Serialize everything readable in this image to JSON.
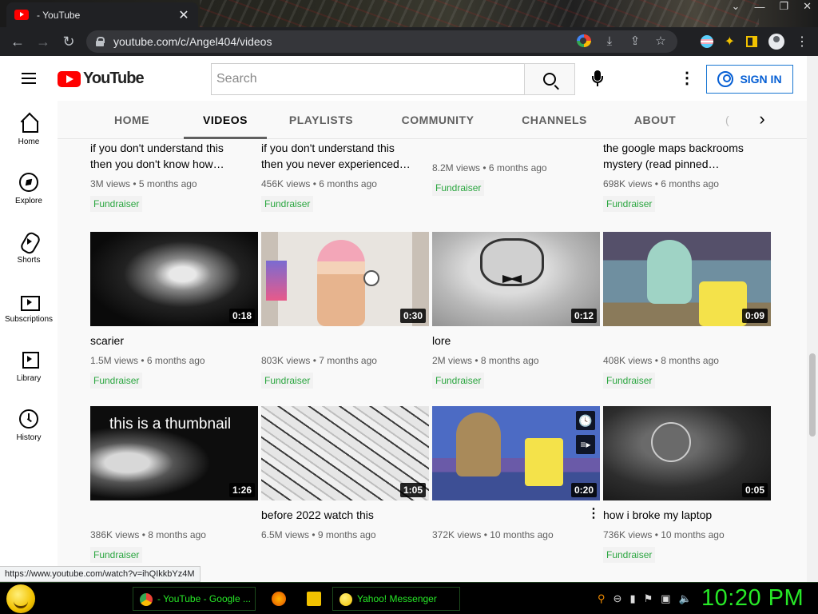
{
  "browser": {
    "tab_title": "- YouTube",
    "tab_close": "✕",
    "url": "youtube.com/c/Angel404/videos",
    "status_url": "https://www.youtube.com/watch?v=ihQIkkbYz4M"
  },
  "youtube": {
    "logo_text": "YouTube",
    "search_placeholder": "Search",
    "signin_label": "SIGN IN"
  },
  "guide": [
    {
      "label": "Home",
      "icon": "home-icon"
    },
    {
      "label": "Explore",
      "icon": "compass-icon"
    },
    {
      "label": "Shorts",
      "icon": "shorts-icon"
    },
    {
      "label": "Subscriptions",
      "icon": "subscriptions-icon"
    },
    {
      "label": "Library",
      "icon": "library-icon"
    },
    {
      "label": "History",
      "icon": "history-icon"
    }
  ],
  "channel_tabs": [
    {
      "label": "HOME"
    },
    {
      "label": "VIDEOS",
      "active": true
    },
    {
      "label": "PLAYLISTS"
    },
    {
      "label": "COMMUNITY"
    },
    {
      "label": "CHANNELS"
    },
    {
      "label": "ABOUT"
    }
  ],
  "videos_row0": [
    {
      "title1": "if you don't understand this",
      "title2": "then you don't know how…",
      "meta": "3M views • 5 months ago",
      "badge": "Fundraiser"
    },
    {
      "title1": "if you don't understand this",
      "title2": "then you never experienced…",
      "meta": "456K views • 6 months ago",
      "badge": "Fundraiser"
    },
    {
      "title1": "",
      "title2": "",
      "meta": "8.2M views • 6 months ago",
      "badge": "Fundraiser"
    },
    {
      "title1": "the google maps backrooms",
      "title2": "mystery (read pinned…",
      "meta": "698K views • 6 months ago",
      "badge": "Fundraiser"
    }
  ],
  "videos_row1": [
    {
      "title": "scarier",
      "duration": "0:18",
      "meta": "1.5M views • 6 months ago",
      "badge": "Fundraiser"
    },
    {
      "title": "",
      "duration": "0:30",
      "meta": "803K views • 7 months ago",
      "badge": "Fundraiser"
    },
    {
      "title": "lore",
      "duration": "0:12",
      "meta": "2M views • 8 months ago",
      "badge": "Fundraiser"
    },
    {
      "title": "",
      "duration": "0:09",
      "meta": "408K views • 8 months ago",
      "badge": "Fundraiser"
    }
  ],
  "videos_row2": [
    {
      "title": "",
      "thumb_caption": "this is a thumbnail",
      "duration": "1:26",
      "meta": "386K views • 8 months ago",
      "badge": "Fundraiser"
    },
    {
      "title": "before 2022 watch this",
      "duration": "1:05",
      "meta": "6.5M views • 9 months ago",
      "badge": ""
    },
    {
      "title": "",
      "duration": "0:20",
      "meta": "372K views • 10 months ago",
      "badge": ""
    },
    {
      "title": "how i broke my laptop",
      "duration": "0:05",
      "meta": "736K views • 10 months ago",
      "badge": "Fundraiser"
    }
  ],
  "taskbar": {
    "chrome_task": "- YouTube - Google ...",
    "messenger_task": "Yahoo! Messenger",
    "clock": "10:20 PM"
  },
  "colors": {
    "yt_red": "#ff0000",
    "fundraiser_green": "#2ba640",
    "taskbar_green": "#27e827",
    "signin_blue": "#065fd4"
  }
}
